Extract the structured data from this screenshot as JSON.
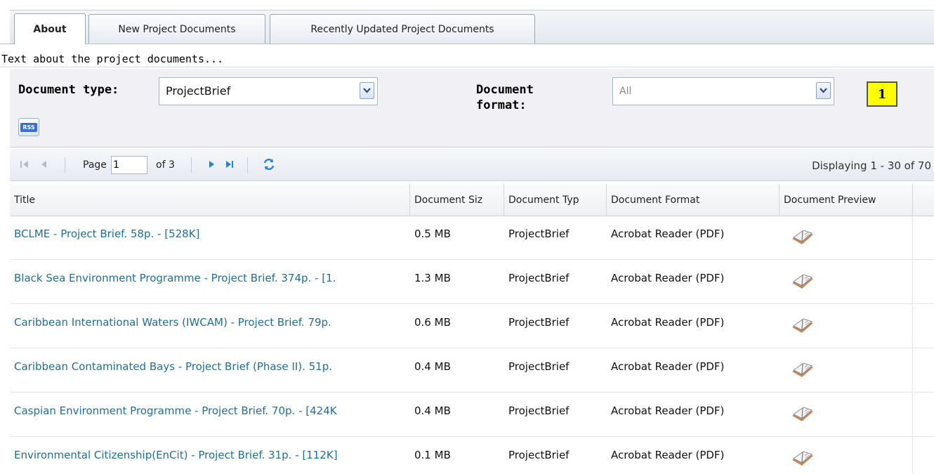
{
  "tabs": [
    {
      "label": "About",
      "active": true
    },
    {
      "label": "New Project Documents",
      "active": false
    },
    {
      "label": "Recently Updated Project Documents",
      "active": false
    }
  ],
  "about_text": "Text about the project documents...",
  "filters": {
    "document_type_label": "Document type:",
    "document_type_value": "ProjectBrief",
    "document_format_label_line1": "Document",
    "document_format_label_line2": "format:",
    "document_format_value": "All",
    "rss_label": "RSS",
    "annotation_badge": "1"
  },
  "pager": {
    "page_label": "Page",
    "current_page": "1",
    "of_label": "of 3",
    "displaying": "Displaying 1 - 30 of 70"
  },
  "columns": [
    "Title",
    "Document Siz",
    "Document Typ",
    "Document Format",
    "Document Preview"
  ],
  "rows": [
    {
      "title": "BCLME - Project Brief. 58p. - [528K]",
      "size": "0.5 MB",
      "type": "ProjectBrief",
      "format": "Acrobat Reader (PDF)",
      "preview": "book-icon"
    },
    {
      "title": "Black Sea Environment Programme - Project Brief. 374p. - [1.",
      "size": "1.3 MB",
      "type": "ProjectBrief",
      "format": "Acrobat Reader (PDF)",
      "preview": "book-icon"
    },
    {
      "title": "Caribbean International Waters (IWCAM) - Project Brief. 79p.",
      "size": "0.6 MB",
      "type": "ProjectBrief",
      "format": "Acrobat Reader (PDF)",
      "preview": "book-icon"
    },
    {
      "title": "Caribbean Contaminated Bays - Project Brief (Phase II). 51p.",
      "size": "0.4 MB",
      "type": "ProjectBrief",
      "format": "Acrobat Reader (PDF)",
      "preview": "book-icon"
    },
    {
      "title": "Caspian Environment Programme - Project Brief. 70p. - [424K",
      "size": "0.4 MB",
      "type": "ProjectBrief",
      "format": "Acrobat Reader (PDF)",
      "preview": "book-icon"
    },
    {
      "title": "Environmental Citizenship(EnCit) - Project Brief. 31p. - [112K]",
      "size": "0.1 MB",
      "type": "ProjectBrief",
      "format": "Acrobat Reader (PDF)",
      "preview": "book-icon"
    }
  ],
  "colors": {
    "link": "#1f6f9a",
    "badge": "#ffff00",
    "refresh": "#2a7fd4"
  }
}
